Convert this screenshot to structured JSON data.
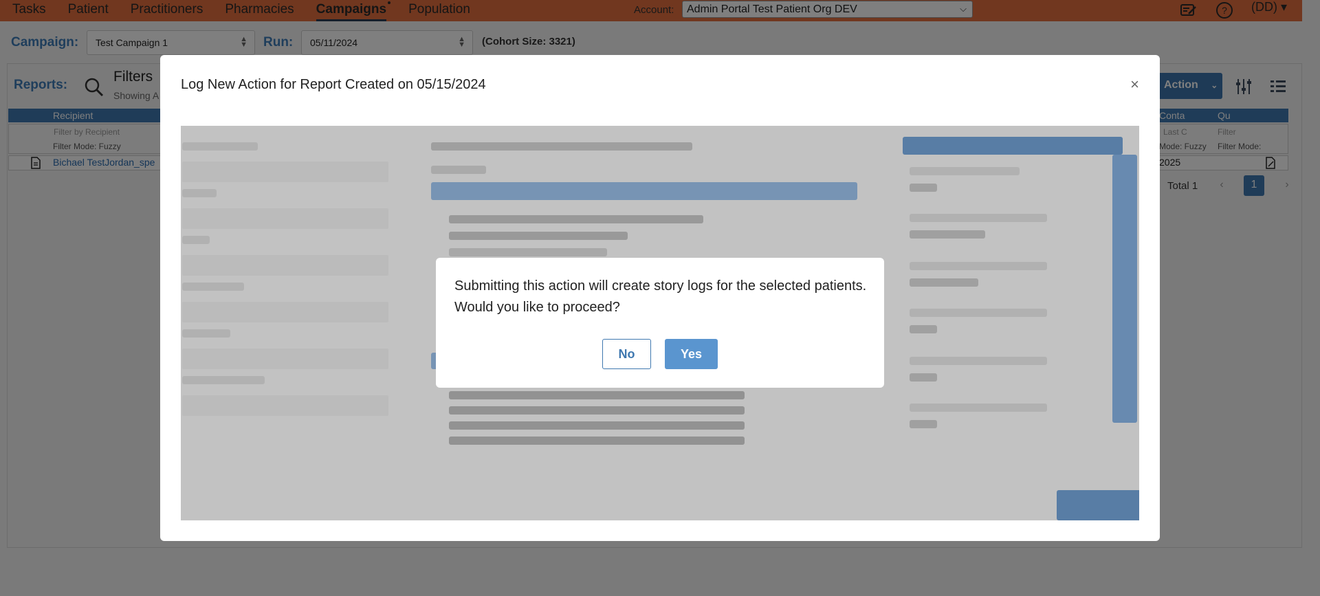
{
  "nav": {
    "items": [
      "Tasks",
      "Patient",
      "Practitioners",
      "Pharmacies",
      "Campaigns",
      "Population"
    ],
    "active_index": 4,
    "account_label": "Account:",
    "account_value": "Admin Portal Test Patient Org DEV",
    "user_label": "(DD)"
  },
  "campaign_bar": {
    "campaign_label": "Campaign:",
    "campaign_value": "Test Campaign 1",
    "run_label": "Run:",
    "run_value": "05/11/2024",
    "cohort_label": "(Cohort Size:",
    "cohort_value": "3321)"
  },
  "reports": {
    "label": "Reports:",
    "filters_title": "Filters",
    "filters_sub": "Showing A",
    "action_label": "Action",
    "columns": {
      "recipient": "Recipient",
      "contact": "Conta",
      "qu": "Qu"
    },
    "filter_placeholders": {
      "recipient": "Filter by Recipient",
      "contact": "Last C",
      "qu": "Filter"
    },
    "filter_modes": {
      "recipient": "Filter Mode: Fuzzy",
      "contact": "Mode: Fuzzy",
      "qu": "Filter Mode:"
    },
    "row": {
      "recipient": "Bichael TestJordan_spe",
      "contact": "2025"
    },
    "pager": {
      "total": "Total 1",
      "page": "1",
      "prev": "‹",
      "next": "›"
    }
  },
  "modal": {
    "title": "Log New Action for Report Created on 05/15/2024",
    "close": "×"
  },
  "confirm": {
    "message": "Submitting this action will create story logs for the selected patients. Would you like to proceed?",
    "no_label": "No",
    "yes_label": "Yes"
  }
}
